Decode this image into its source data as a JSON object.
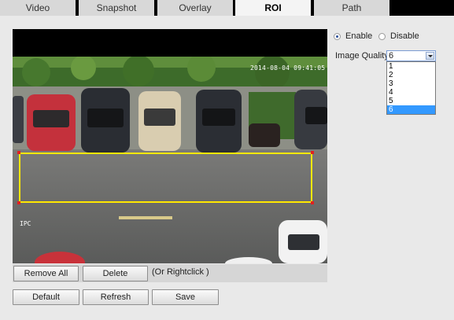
{
  "tabs": [
    {
      "label": "Video",
      "active": false
    },
    {
      "label": "Snapshot",
      "active": false
    },
    {
      "label": "Overlay",
      "active": false
    },
    {
      "label": "ROI",
      "active": true
    },
    {
      "label": "Path",
      "active": false
    }
  ],
  "video": {
    "timestamp": "2014-08-04 09:41:05",
    "camera_label": "IPC"
  },
  "buttons": {
    "remove_all": "Remove All",
    "delete": "Delete",
    "hint": "(Or Rightclick )",
    "default": "Default",
    "refresh": "Refresh",
    "save": "Save"
  },
  "settings": {
    "enable_label": "Enable",
    "disable_label": "Disable",
    "enabled": true,
    "image_quality_label": "Image Quality",
    "image_quality_value": "6",
    "image_quality_options": [
      "1",
      "2",
      "3",
      "4",
      "5",
      "6"
    ]
  },
  "colors": {
    "roi_border": "#ffe800",
    "roi_handle": "#e02020",
    "selected_option": "#3399ff"
  }
}
